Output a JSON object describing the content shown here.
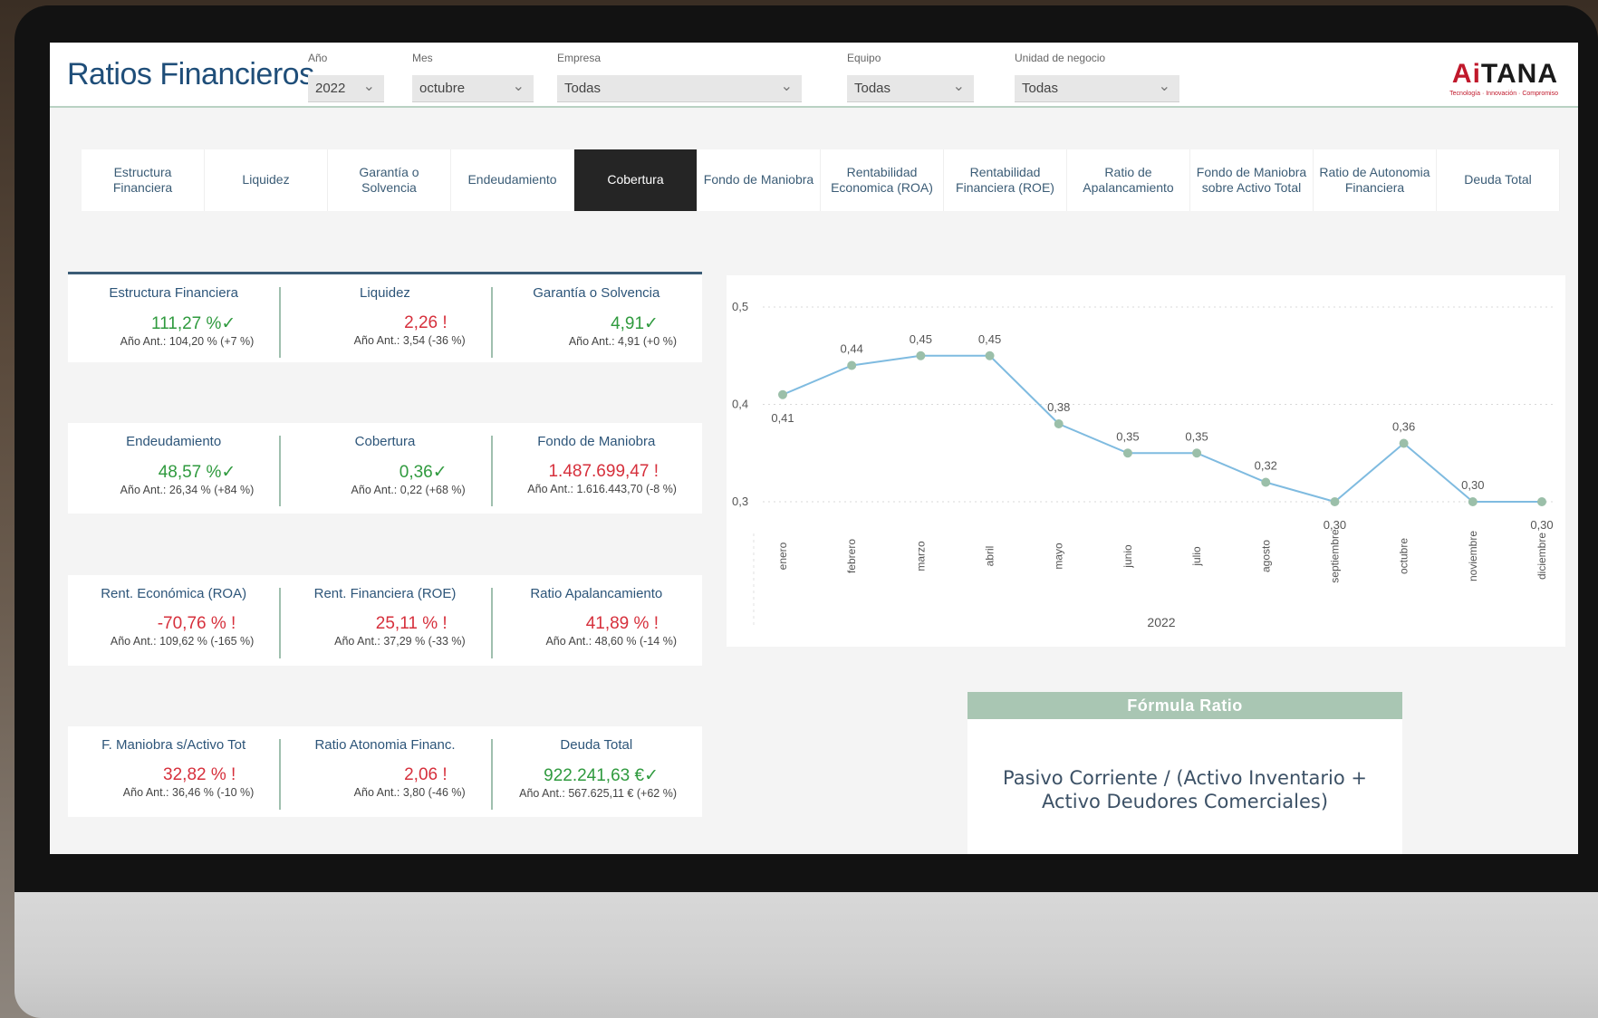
{
  "header": {
    "title": "Ratios Financieros",
    "filters": [
      {
        "label": "Año",
        "value": "2022"
      },
      {
        "label": "Mes",
        "value": "octubre"
      },
      {
        "label": "Empresa",
        "value": "Todas"
      },
      {
        "label": "Equipo",
        "value": "Todas"
      },
      {
        "label": "Unidad de negocio",
        "value": "Todas"
      }
    ],
    "logo": {
      "prefix": "Ai",
      "main": "TANA",
      "tagline": "Tecnología · Innovación · Compromiso"
    }
  },
  "tabs": [
    {
      "label": "Estructura Financiera",
      "active": false
    },
    {
      "label": "Liquidez",
      "active": false
    },
    {
      "label": "Garantía o Solvencia",
      "active": false
    },
    {
      "label": "Endeudamiento",
      "active": false
    },
    {
      "label": "Cobertura",
      "active": true
    },
    {
      "label": "Fondo de Maniobra",
      "active": false
    },
    {
      "label": "Rentabilidad Economica (ROA)",
      "active": false
    },
    {
      "label": "Rentabilidad Financiera (ROE)",
      "active": false
    },
    {
      "label": "Ratio de Apalancamiento",
      "active": false
    },
    {
      "label": "Fondo de Maniobra sobre Activo Total",
      "active": false
    },
    {
      "label": "Ratio de Autonomia Financiera",
      "active": false
    },
    {
      "label": "Deuda Total",
      "active": false
    }
  ],
  "kpis": [
    [
      {
        "title": "Estructura Financiera",
        "value": "111,27 %✓",
        "status": "good",
        "prev": "Año Ant.: 104,20 % (+7 %)"
      },
      {
        "title": "Liquidez",
        "value": "2,26 !",
        "status": "bad",
        "prev": "Año Ant.: 3,54 (-36 %)"
      },
      {
        "title": "Garantía o Solvencia",
        "value": "4,91✓",
        "status": "good",
        "prev": "Año Ant.: 4,91 (+0 %)"
      }
    ],
    [
      {
        "title": "Endeudamiento",
        "value": "48,57 %✓",
        "status": "good",
        "prev": "Año Ant.: 26,34 % (+84 %)"
      },
      {
        "title": "Cobertura",
        "value": "0,36✓",
        "status": "good",
        "prev": "Año Ant.: 0,22 (+68 %)"
      },
      {
        "title": "Fondo de Maniobra",
        "value": "1.487.699,47 !",
        "status": "bad",
        "prev": "Año Ant.: 1.616.443,70 (-8 %)"
      }
    ],
    [
      {
        "title": "Rent. Económica (ROA)",
        "value": "-70,76 % !",
        "status": "bad",
        "prev": "Año Ant.: 109,62 % (-165 %)"
      },
      {
        "title": "Rent. Financiera (ROE)",
        "value": "25,11 % !",
        "status": "bad",
        "prev": "Año Ant.: 37,29 % (-33 %)"
      },
      {
        "title": "Ratio Apalancamiento",
        "value": "41,89 % !",
        "status": "bad",
        "prev": "Año Ant.: 48,60 % (-14 %)"
      }
    ],
    [
      {
        "title": "F. Maniobra s/Activo Tot",
        "value": "32,82 % !",
        "status": "bad",
        "prev": "Año Ant.: 36,46 % (-10 %)"
      },
      {
        "title": "Ratio Atonomia Financ.",
        "value": "2,06 !",
        "status": "bad",
        "prev": "Año Ant.: 3,80 (-46 %)"
      },
      {
        "title": "Deuda Total",
        "value": "922.241,63 €✓",
        "status": "good",
        "prev": "Año Ant.: 567.625,11 € (+62 %)"
      }
    ]
  ],
  "chart_data": {
    "type": "line",
    "categories": [
      "enero",
      "febrero",
      "marzo",
      "abril",
      "mayo",
      "junio",
      "julio",
      "agosto",
      "septiembre",
      "octubre",
      "noviembre",
      "diciembre"
    ],
    "values": [
      0.41,
      0.44,
      0.45,
      0.45,
      0.38,
      0.35,
      0.35,
      0.32,
      0.3,
      0.36,
      0.3,
      0.3
    ],
    "value_labels": [
      "0,41",
      "0,44",
      "0,45",
      "0,45",
      "0,38",
      "0,35",
      "0,35",
      "0,32",
      "0,30",
      "0,36",
      "0,30",
      "0,30"
    ],
    "yticks": [
      "0,5",
      "0,4",
      "0,3"
    ],
    "ytick_values": [
      0.5,
      0.4,
      0.3
    ],
    "ylim": [
      0.3,
      0.5
    ],
    "xlabel": "2022",
    "grid": true,
    "colors": {
      "line": "#7fbbe0",
      "marker": "#9bbfa9"
    }
  },
  "formula": {
    "title": "Fórmula Ratio",
    "text": "Pasivo Corriente / (Activo Inventario + Activo Deudores Comerciales)"
  }
}
